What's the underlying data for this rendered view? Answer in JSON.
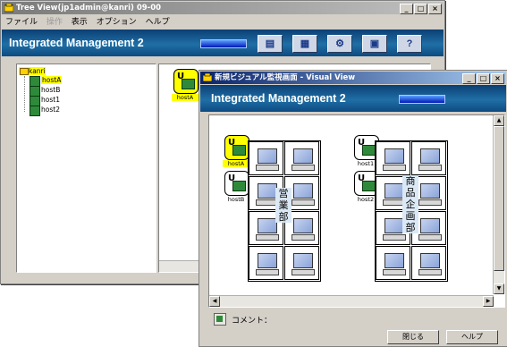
{
  "tree_window": {
    "title": "Tree View(jp1admin@kanri) 09-00",
    "menu": [
      {
        "label": "ファイル",
        "disabled": false
      },
      {
        "label": "操作",
        "disabled": true
      },
      {
        "label": "表示",
        "disabled": false
      },
      {
        "label": "オプション",
        "disabled": false
      },
      {
        "label": "ヘルプ",
        "disabled": false
      }
    ],
    "banner_title": "Integrated Management 2",
    "toolbar_icons": [
      "monitor-icon",
      "network-icon",
      "settings-icon",
      "event-icon",
      "help-icon"
    ],
    "toolbar_glyphs": [
      "▤",
      "▦",
      "⚙",
      "▣",
      "?"
    ],
    "help_label": "?",
    "tree": {
      "root": "kanri",
      "children": [
        "hostA",
        "hostB",
        "host1",
        "host2"
      ],
      "selected": "hostA"
    },
    "detail_icon_label": "hostA"
  },
  "visual_window": {
    "title": "新規ビジュアル監視画面 - Visual View",
    "banner_title": "Integrated Management 2",
    "groups": [
      {
        "dept_label": [
          "営",
          "業",
          "部"
        ],
        "hosts": [
          "hostA",
          "hostB"
        ],
        "selected_host": "hostA"
      },
      {
        "dept_label": [
          "商",
          "品",
          "企",
          "画",
          "部"
        ],
        "hosts": [
          "host1",
          "host2"
        ],
        "selected_host": ""
      }
    ],
    "comment_label": "コメント：",
    "close_button": "閉じる",
    "help_button": "ヘルプ"
  },
  "window_buttons": {
    "minimize": "_",
    "maximize": "□",
    "close": "×"
  },
  "colors": {
    "titlebar_active": "#0a246a",
    "banner": "#1f6fa6",
    "selection": "#ffff00",
    "host_icon": "#2e8a3a"
  }
}
